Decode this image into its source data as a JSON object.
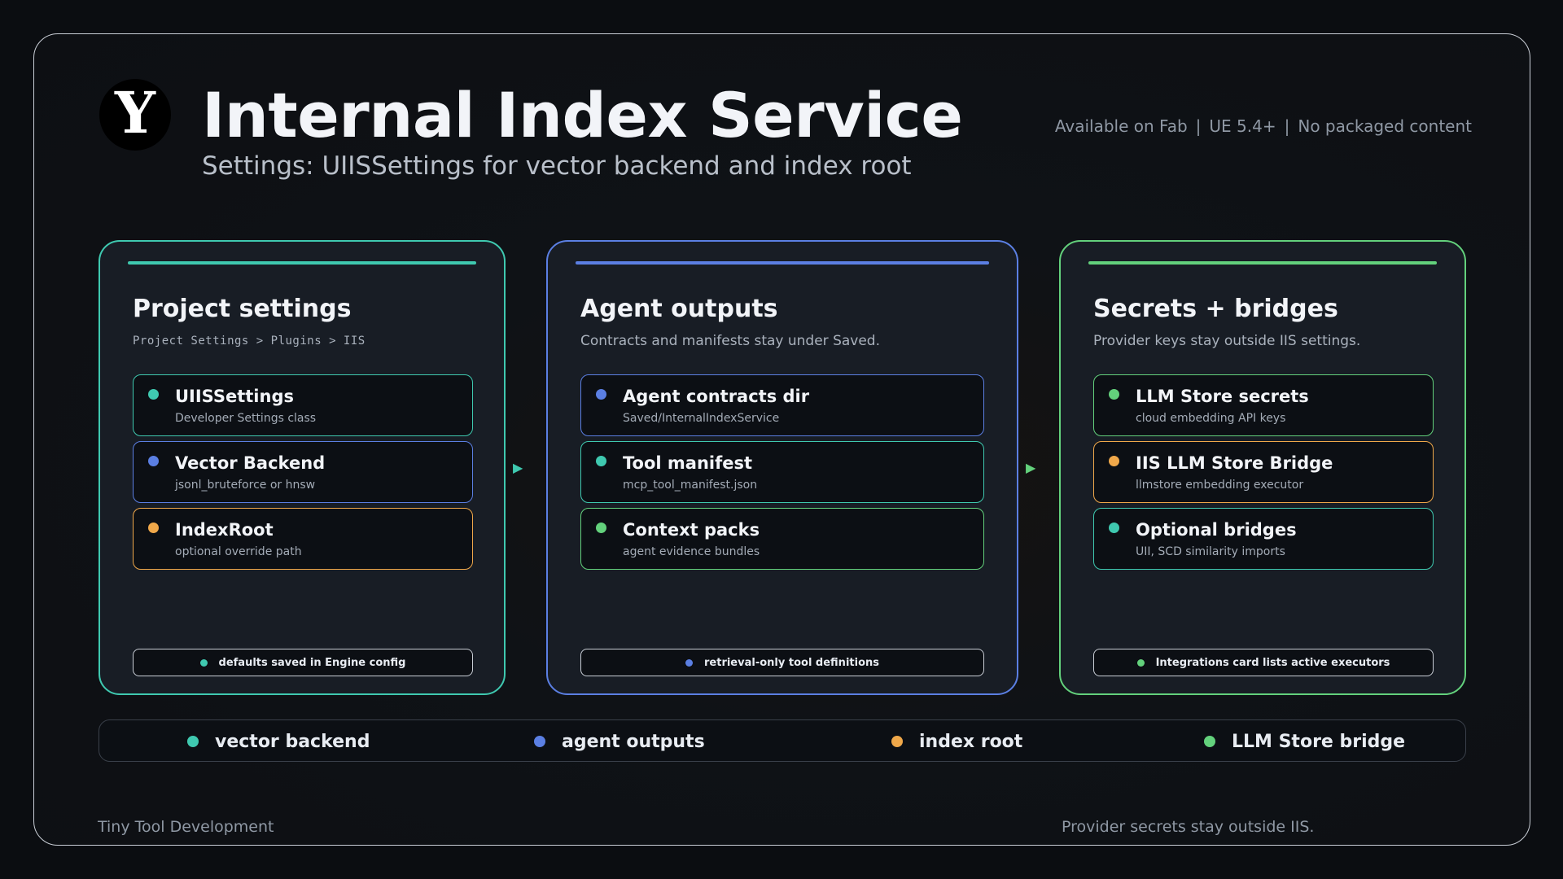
{
  "header": {
    "logo_letter": "Y",
    "title": "Internal Index Service",
    "subtitle": "Settings: UIISSettings for vector backend and index root",
    "meta": [
      "Available on Fab",
      "UE 5.4+",
      "No packaged content"
    ],
    "meta_separator": "|"
  },
  "colors": {
    "teal": "#3fc9b0",
    "blue": "#5b7fe3",
    "orange": "#f0a84a",
    "green": "#63d17c"
  },
  "panels": [
    {
      "title": "Project settings",
      "caption": "Project Settings > Plugins > IIS",
      "cards": [
        {
          "title": "UIISSettings",
          "subtitle": "Developer Settings class",
          "color": "teal"
        },
        {
          "title": "Vector Backend",
          "subtitle": "jsonl_bruteforce or hnsw",
          "color": "blue"
        },
        {
          "title": "IndexRoot",
          "subtitle": "optional override path",
          "color": "orange"
        }
      ],
      "footer": "defaults saved in Engine config",
      "footer_color": "teal"
    },
    {
      "title": "Agent outputs",
      "caption": "Contracts and manifests stay under Saved.",
      "cards": [
        {
          "title": "Agent contracts dir",
          "subtitle": "Saved/InternalIndexService",
          "color": "blue"
        },
        {
          "title": "Tool manifest",
          "subtitle": "mcp_tool_manifest.json",
          "color": "teal"
        },
        {
          "title": "Context packs",
          "subtitle": "agent evidence bundles",
          "color": "green"
        }
      ],
      "footer": "retrieval-only tool definitions",
      "footer_color": "blue"
    },
    {
      "title": "Secrets + bridges",
      "caption": "Provider keys stay outside IIS settings.",
      "cards": [
        {
          "title": "LLM Store secrets",
          "subtitle": "cloud embedding API keys",
          "color": "green"
        },
        {
          "title": "IIS LLM Store Bridge",
          "subtitle": "llmstore embedding executor",
          "color": "orange"
        },
        {
          "title": "Optional bridges",
          "subtitle": "UII, SCD similarity imports",
          "color": "teal"
        }
      ],
      "footer": "Integrations card lists active executors",
      "footer_color": "green"
    }
  ],
  "arrows": [
    {
      "glyph": "▶",
      "color": "teal"
    },
    {
      "glyph": "▶",
      "color": "green"
    }
  ],
  "legend": [
    {
      "label": "vector backend",
      "color": "teal"
    },
    {
      "label": "agent outputs",
      "color": "blue"
    },
    {
      "label": "index root",
      "color": "orange"
    },
    {
      "label": "LLM Store bridge",
      "color": "green"
    }
  ],
  "footer": {
    "left": "Tiny Tool Development",
    "right": "Provider secrets stay outside IIS."
  }
}
